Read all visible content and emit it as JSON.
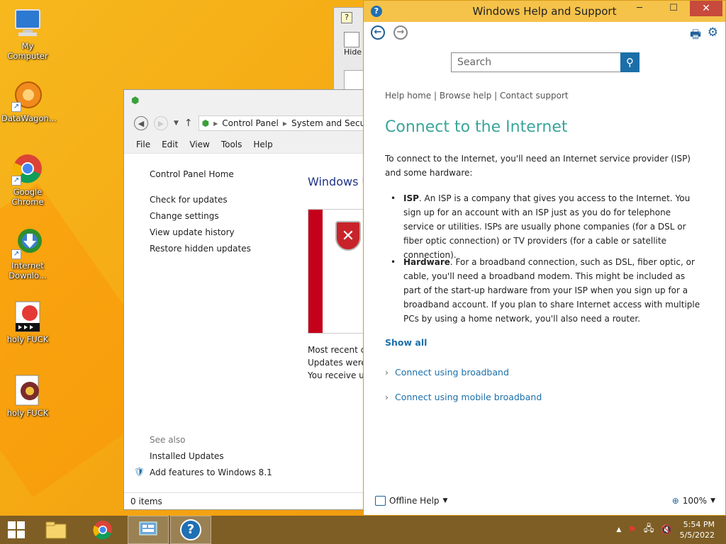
{
  "desktop": {
    "icons": [
      {
        "label": "My Computer",
        "glyph": "🖥"
      },
      {
        "label": "DataWagon...",
        "glyph": "✹"
      },
      {
        "label": "Google Chrome",
        "glyph": ""
      },
      {
        "label": "Internet Downlo...",
        "glyph": "⬇"
      },
      {
        "label": "holy FUCK",
        "glyph": "✱"
      },
      {
        "label": "holy FUCK",
        "glyph": "◎"
      }
    ]
  },
  "hidden_window": {
    "hide_label": "Hide"
  },
  "control_panel": {
    "breadcrumb": [
      "Control Panel",
      "System and Secu"
    ],
    "menu": [
      "File",
      "Edit",
      "View",
      "Tools",
      "Help"
    ],
    "home_link": "Control Panel Home",
    "side_links": [
      "Check for updates",
      "Change settings",
      "View update history",
      "Restore hidden updates"
    ],
    "see_also_label": "See also",
    "see_also_links": [
      "Installed Updates",
      "Add features to Windows 8.1"
    ],
    "main_title": "Windows U",
    "info_lines": [
      "Most recent ch",
      "Updates were i",
      "You receive up"
    ],
    "status": "0 items"
  },
  "help_window": {
    "title": "Windows Help and Support",
    "search_placeholder": "Search",
    "top_links": [
      "Help home",
      "Browse help",
      "Contact support"
    ],
    "heading": "Connect to the Internet",
    "intro": "To connect to the Internet, you'll need an Internet service provider (ISP) and some hardware:",
    "bullets": [
      {
        "term": "ISP",
        "text": ". An ISP is a company that gives you access to the Internet. You sign up for an account with an ISP just as you do for telephone service or utilities. ISPs are usually phone companies (for a DSL or fiber optic connection) or TV providers (for a cable or satellite connection)."
      },
      {
        "term": "Hardware",
        "text": ". For a broadband connection, such as DSL, fiber optic, or cable, you'll need a broadband modem. This might be included as part of the start-up hardware from your ISP when you sign up for a broadband account. If you plan to share Internet access with multiple PCs by using a home network, you'll also need a router."
      }
    ],
    "show_all": "Show all",
    "expanders": [
      "Connect using broadband",
      "Connect using mobile broadband"
    ],
    "offline_help": "Offline Help",
    "zoom": "100%"
  },
  "taskbar": {
    "time": "5:54 PM",
    "date": "5/5/2022"
  },
  "colors": {
    "accent_teal": "#3aa59a",
    "link_blue": "#1b6fa8",
    "title_gold": "#f5c24a",
    "close_red": "#c74a3c"
  }
}
